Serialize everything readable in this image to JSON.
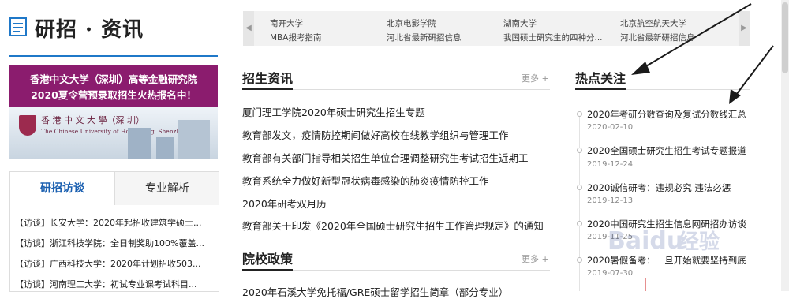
{
  "header": {
    "title": "研招 · 资讯",
    "ticker": [
      "南开大学",
      "北京电影学院",
      "湖南大学",
      "北京航空航天大学",
      "MBA报考指南",
      "河北省最新研招信息",
      "我国硕士研究生的四种分...",
      "河北省最新研招信息"
    ]
  },
  "banner": {
    "line1": "香港中文大学（深圳）高等金融研究院",
    "line2": "2020夏令营预录取招生火热报名中！",
    "school_cn": "香 港 中 文 大 學（深 圳）",
    "school_en": "The Chinese University of Hong Kong, Shenzhen"
  },
  "tabs": {
    "active": "研招访谈",
    "inactive": "专业解析",
    "items": [
      "【访谈】长安大学：2020年起招收建筑学硕士...",
      "【访谈】浙江科技学院：全日制奖助100%覆盖...",
      "【访谈】广西科技大学：2020年计划招收503...",
      "【访谈】河南理工大学：初试专业课考试科目..."
    ]
  },
  "admissions": {
    "title": "招生资讯",
    "more": "更多 +",
    "items": [
      "厦门理工学院2020年硕士研究生招生专题",
      "教育部发文，疫情防控期间做好高校在线教学组织与管理工作",
      "教育部有关部门指导相关招生单位合理调整研究生考试招生近期工",
      "教育系统全力做好新型冠状病毒感染的肺炎疫情防控工作",
      "2020年研考双月历",
      "教育部关于印发《2020年全国硕士研究生招生工作管理规定》的通知"
    ]
  },
  "policy": {
    "title": "院校政策",
    "more": "更多 +",
    "first_item": "2020年石溪大学免托福/GRE硕士留学招生简章（部分专业）"
  },
  "hot": {
    "title": "热点关注",
    "items": [
      {
        "text": "2020年考研分数查询及复试分数线汇总",
        "date": "2020-02-10"
      },
      {
        "text": "2020全国硕士研究生招生考试专题报道",
        "date": "2019-12-24"
      },
      {
        "text": "2020诚信研考：违规必究 违法必惩",
        "date": "2019-12-13"
      },
      {
        "text": "2020中国研究生招生信息网研招办访谈",
        "date": "2019-11-25"
      },
      {
        "text": "2020暑假备考：一旦开始就要坚持到底",
        "date": "2019-07-30"
      }
    ]
  },
  "colors": {
    "accent": "#1f78c8",
    "banner_bg": "#8b1c6e",
    "arrow": "#1a1a1a"
  }
}
